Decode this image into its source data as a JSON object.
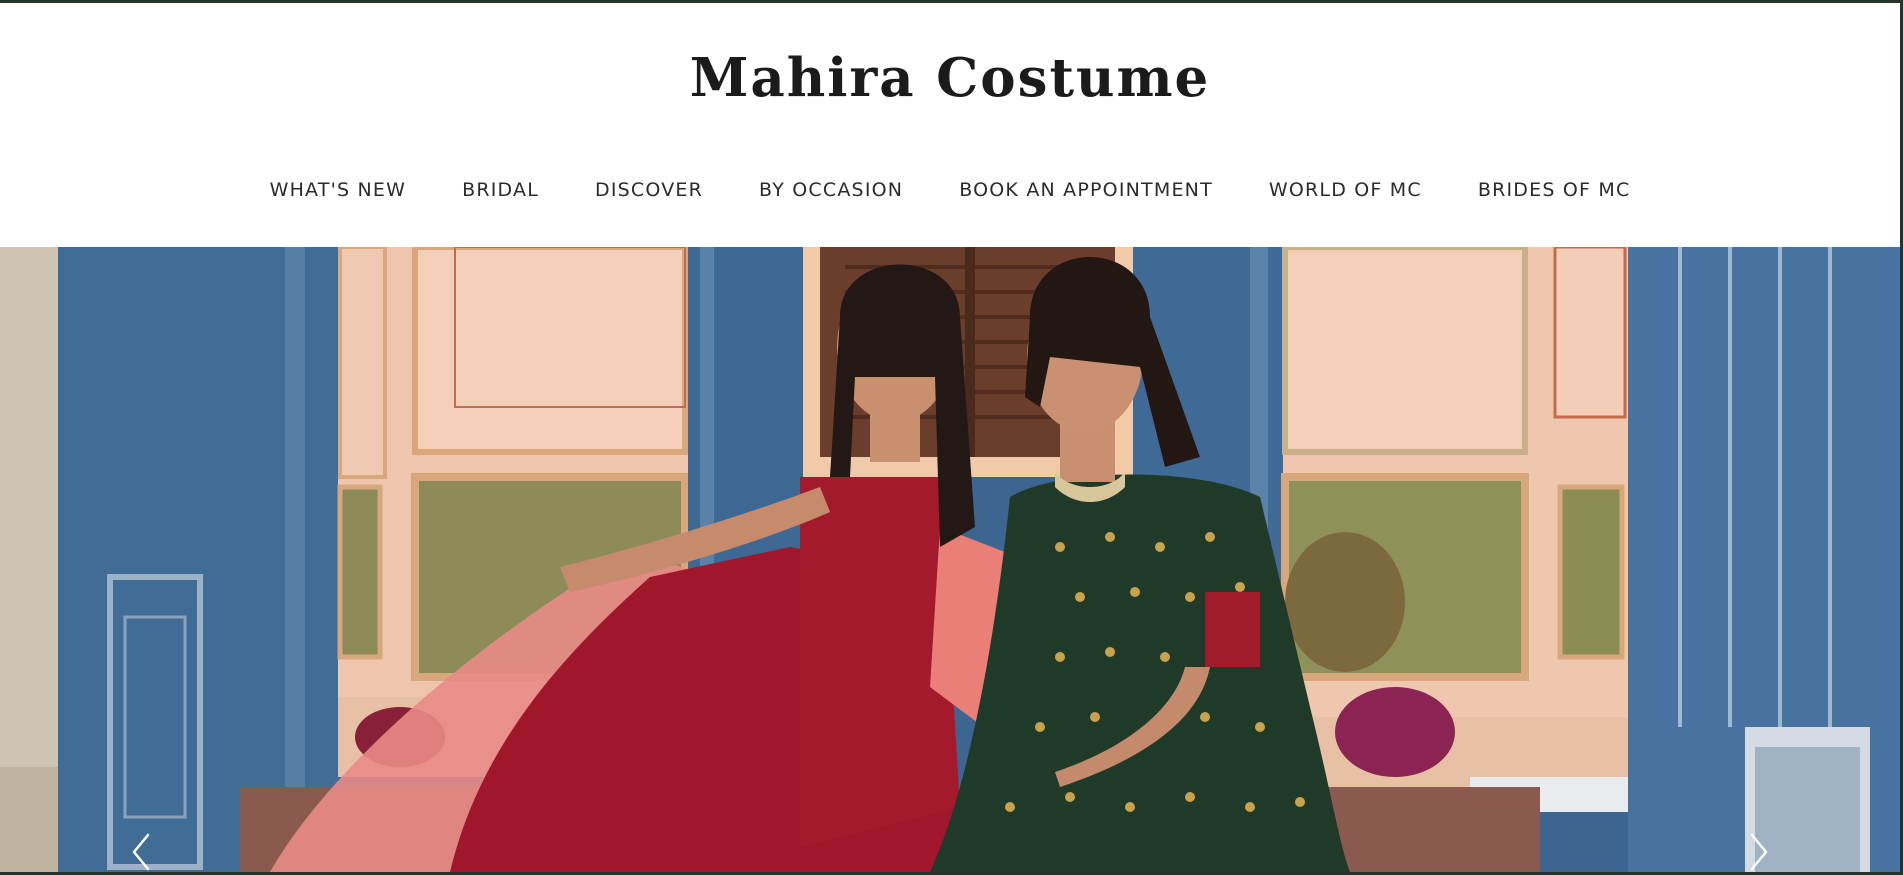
{
  "brand": {
    "name": "Mahira Costume"
  },
  "nav": {
    "items": [
      {
        "label": "WHAT'S NEW",
        "name": "nav-whats-new"
      },
      {
        "label": "BRIDAL",
        "name": "nav-bridal"
      },
      {
        "label": "DISCOVER",
        "name": "nav-discover"
      },
      {
        "label": "BY OCCASION",
        "name": "nav-by-occasion"
      },
      {
        "label": "BOOK AN APPOINTMENT",
        "name": "nav-book-an-appointment"
      },
      {
        "label": "WORLD OF MC",
        "name": "nav-world-of-mc"
      },
      {
        "label": "BRIDES OF MC",
        "name": "nav-brides-of-mc"
      }
    ]
  },
  "hero": {
    "prev_icon": "chevron-left-icon",
    "next_icon": "chevron-right-icon"
  },
  "colors": {
    "frame": "#26332b",
    "text": "#1b1b1b",
    "wall_blue": "#3f6b95",
    "wall_peach": "#efc7b0",
    "panel_olive": "#8a8a52",
    "outfit_red": "#9e1625",
    "outfit_pink": "#e3877a",
    "outfit_green": "#1f3b2a"
  }
}
